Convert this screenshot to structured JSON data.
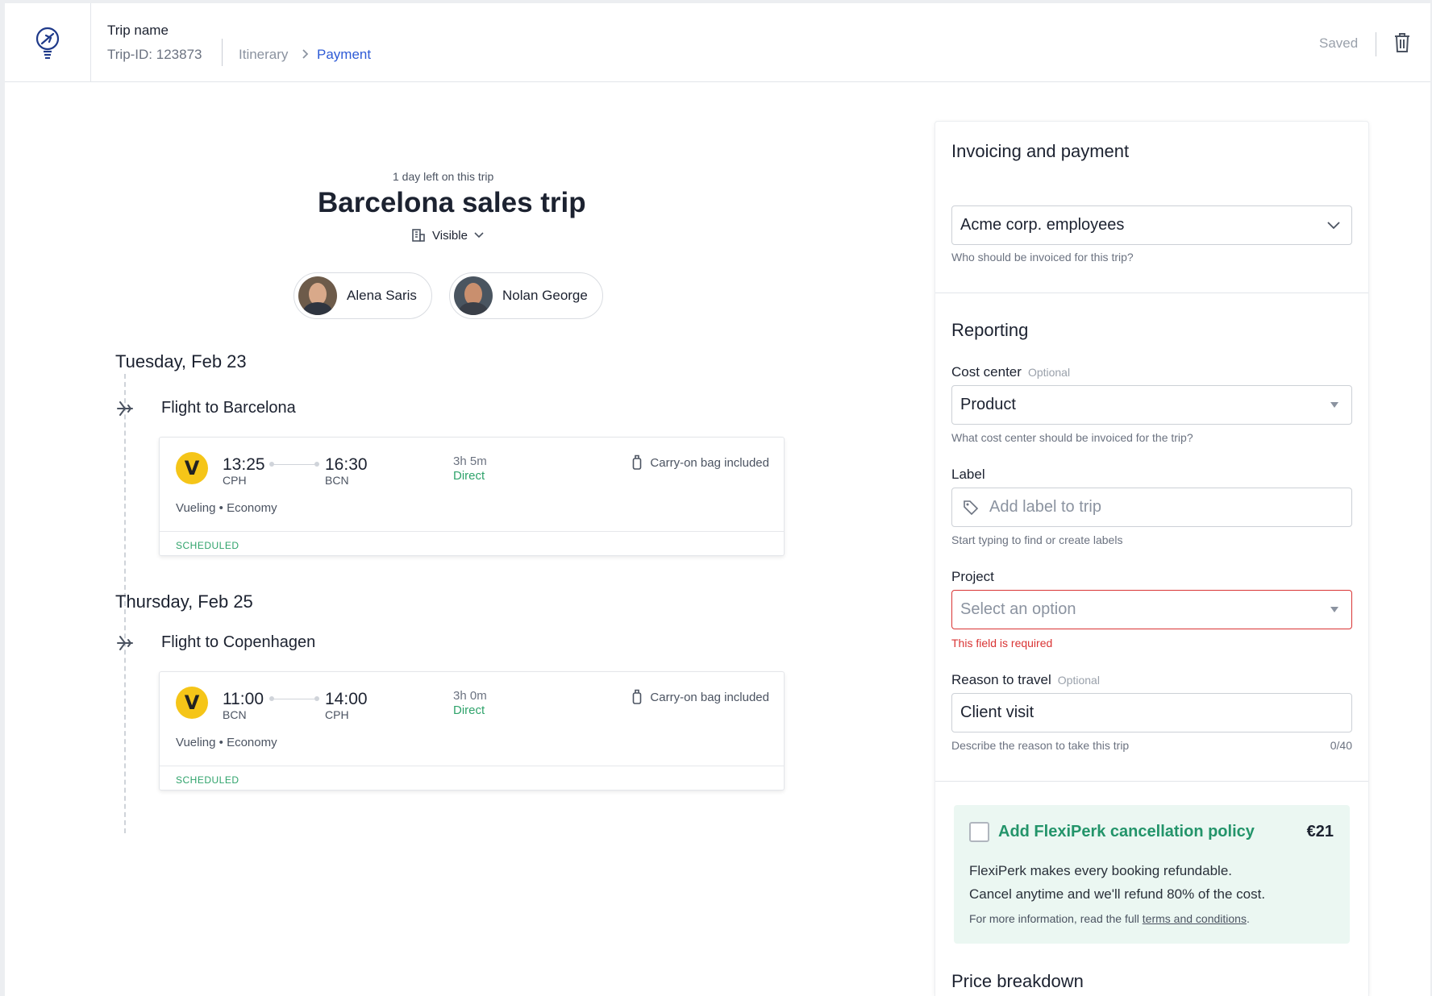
{
  "header": {
    "trip_name": "Trip name",
    "trip_id": "Trip-ID: 123873",
    "breadcrumb": {
      "itinerary": "Itinerary",
      "payment": "Payment"
    },
    "saved_status": "Saved",
    "accent_color": "#2e5bd6"
  },
  "trip": {
    "days_left": "1 day left on this trip",
    "title": "Barcelona sales trip",
    "visibility": "Visible",
    "travelers": [
      {
        "name": "Alena Saris"
      },
      {
        "name": "Nolan George"
      }
    ]
  },
  "itinerary": [
    {
      "date": "Tuesday, Feb 23",
      "flight_title": "Flight to Barcelona",
      "airline_logo_letter": "V",
      "dep_time": "13:25",
      "dep_code": "CPH",
      "arr_time": "16:30",
      "arr_code": "BCN",
      "duration": "3h 5m",
      "stops": "Direct",
      "bag": "Carry-on bag included",
      "airline_class": "Vueling • Economy",
      "status": "SCHEDULED"
    },
    {
      "date": "Thursday, Feb 25",
      "flight_title": "Flight to Copenhagen",
      "airline_logo_letter": "V",
      "dep_time": "11:00",
      "dep_code": "BCN",
      "arr_time": "14:00",
      "arr_code": "CPH",
      "duration": "3h 0m",
      "stops": "Direct",
      "bag": "Carry-on bag included",
      "airline_class": "Vueling • Economy",
      "status": "SCHEDULED"
    }
  ],
  "invoicing": {
    "title": "Invoicing and payment",
    "invoice_to": "Acme corp. employees",
    "invoice_help": "Who should be invoiced for this trip?"
  },
  "reporting": {
    "title": "Reporting",
    "optional_label": "Optional",
    "cost_center": {
      "label": "Cost center",
      "value": "Product",
      "help": "What cost center should be invoiced for the trip?"
    },
    "label_field": {
      "label": "Label",
      "placeholder": "Add label to trip",
      "help": "Start typing to find or create labels"
    },
    "project": {
      "label": "Project",
      "placeholder": "Select an option",
      "error": "This field is required"
    },
    "reason": {
      "label": "Reason to travel",
      "value": "Client visit",
      "help": "Describe the reason to take this trip",
      "counter": "0/40"
    }
  },
  "flexiperk": {
    "title": "Add FlexiPerk cancellation policy",
    "price": "€21",
    "desc1": "FlexiPerk makes every booking refundable.",
    "desc2": "Cancel anytime and we'll refund 80% of the cost.",
    "more_prefix": "For more information, read the full ",
    "more_link": "terms and conditions",
    "more_suffix": ".",
    "checked": false
  },
  "price_breakdown": {
    "title": "Price breakdown"
  },
  "icons": [
    "plane-bulb-logo-icon",
    "chevron-right-icon",
    "trash-icon",
    "building-icon",
    "chevron-down-icon",
    "airplane-icon",
    "luggage-icon",
    "tag-icon"
  ]
}
